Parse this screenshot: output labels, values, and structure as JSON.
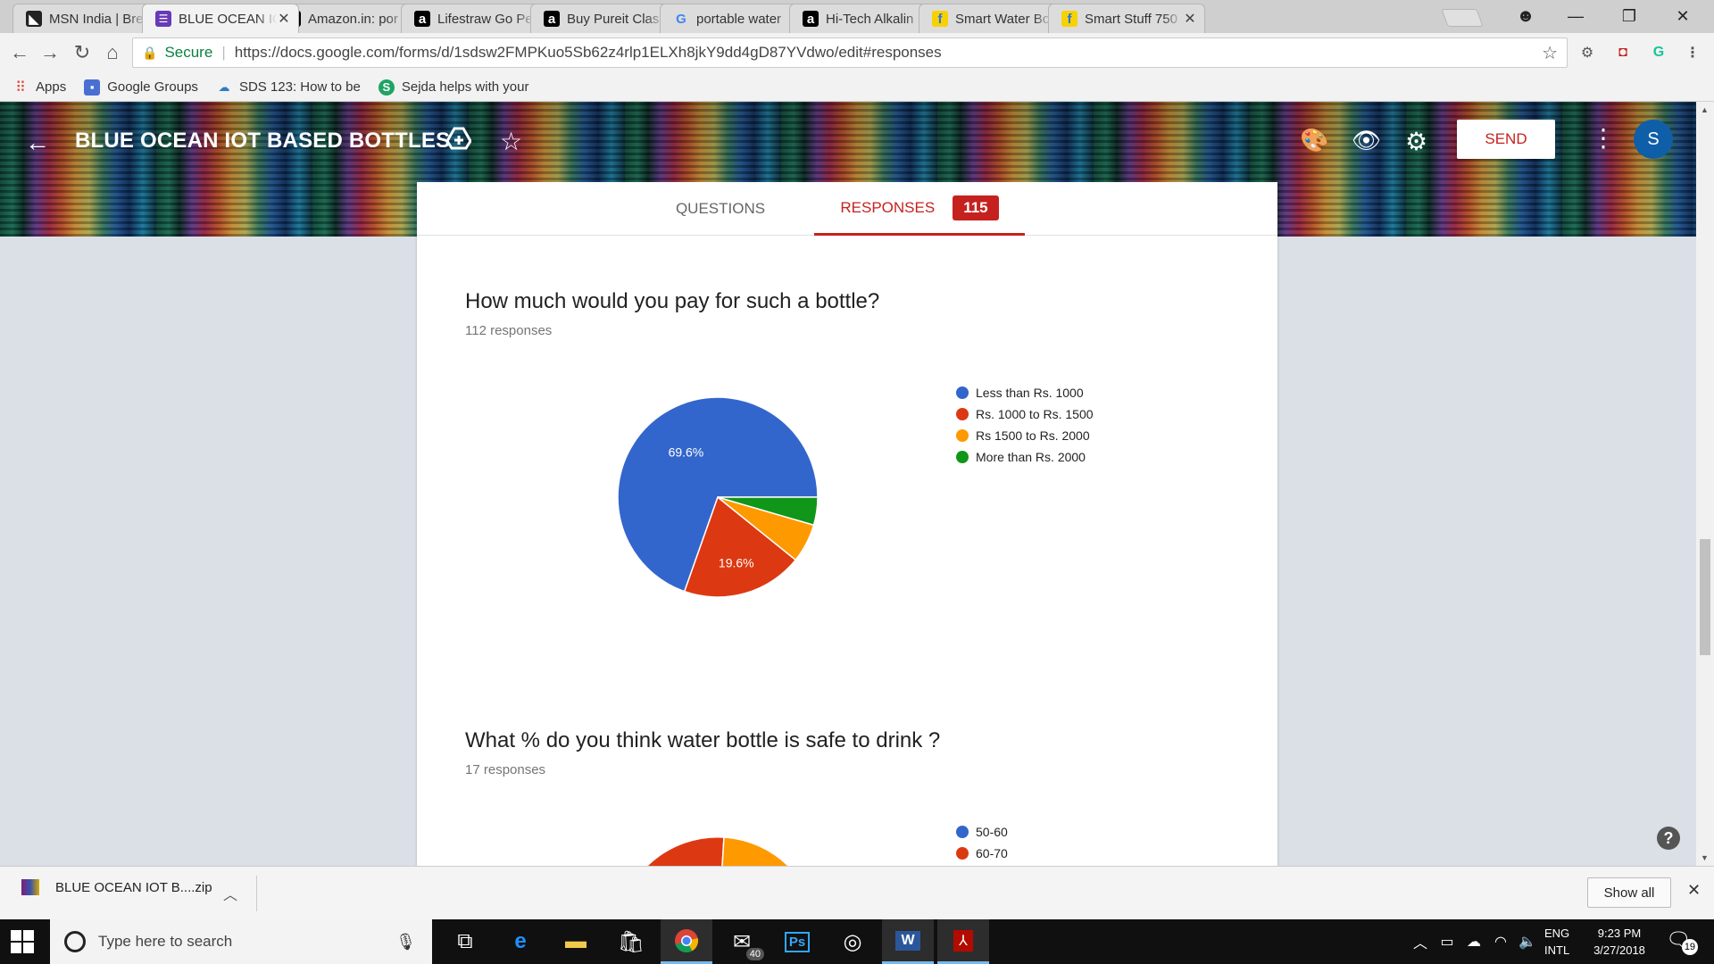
{
  "browser": {
    "tabs": [
      {
        "title": "MSN India | Bre",
        "icon": "msn-icon",
        "color": "#222222",
        "glyph": "◣",
        "active": false
      },
      {
        "title": "BLUE OCEAN IC",
        "icon": "google-forms-icon",
        "color": "#673ab7",
        "glyph": "☰",
        "active": true
      },
      {
        "title": "Amazon.in: por",
        "icon": "amazon-icon",
        "color": "#000000",
        "glyph": "a",
        "active": false
      },
      {
        "title": "Lifestraw Go Pe",
        "icon": "amazon-icon",
        "color": "#000000",
        "glyph": "a",
        "active": false
      },
      {
        "title": "Buy Pureit Clas",
        "icon": "amazon-icon",
        "color": "#000000",
        "glyph": "a",
        "active": false
      },
      {
        "title": "portable water",
        "icon": "google-icon",
        "color": "#4285f4",
        "glyph": "G",
        "active": false
      },
      {
        "title": "Hi-Tech Alkalin",
        "icon": "amazon-icon",
        "color": "#000000",
        "glyph": "a",
        "active": false
      },
      {
        "title": "Smart Water Bo",
        "icon": "flipkart-icon",
        "color": "#f7d200",
        "glyph": "f",
        "active": false
      },
      {
        "title": "Smart Stuff 750",
        "icon": "flipkart-icon",
        "color": "#f7d200",
        "glyph": "f",
        "active": false
      }
    ],
    "address": {
      "secure_label": "Secure",
      "url": "https://docs.google.com/forms/d/1sdsw2FMPKuo5Sb62z4rlp1ELXh8jkY9dd4gD87YVdwo/edit#responses"
    },
    "bookmarks": [
      {
        "label": "Apps",
        "icon": "apps-grid-icon"
      },
      {
        "label": "Google Groups",
        "icon": "google-groups-icon"
      },
      {
        "label": "SDS 123: How to be",
        "icon": "sds-icon"
      },
      {
        "label": "Sejda helps with your",
        "icon": "sejda-icon"
      }
    ]
  },
  "form": {
    "title": "BLUE OCEAN IOT BASED BOTTLES",
    "send_label": "SEND",
    "avatar_initial": "S",
    "tabs": {
      "questions": "QUESTIONS",
      "responses": "RESPONSES",
      "response_count": "115"
    },
    "questions": [
      {
        "title": "How much would you pay for such a bottle?",
        "responses": "112 responses"
      },
      {
        "title": "What % do you think water bottle is safe to drink ?",
        "responses": "17 responses"
      }
    ]
  },
  "chart_data": [
    {
      "type": "pie",
      "categories": [
        "Less than Rs. 1000",
        "Rs. 1000 to Rs. 1500",
        "Rs 1500 to Rs. 2000",
        "More than Rs. 2000"
      ],
      "values": [
        69.6,
        19.6,
        6.3,
        4.5
      ],
      "colors": [
        "#3366cc",
        "#dc3912",
        "#ff9900",
        "#109618"
      ],
      "data_labels": [
        "69.6%",
        "19.6%",
        "",
        ""
      ],
      "legend_position": "right"
    },
    {
      "type": "pie",
      "categories": [
        "50-60",
        "60-70"
      ],
      "colors": [
        "#3366cc",
        "#dc3912"
      ],
      "legend_position": "right"
    }
  ],
  "downloads": {
    "file": "BLUE OCEAN IOT B....zip",
    "show_all": "Show all"
  },
  "taskbar": {
    "search_placeholder": "Type here to search",
    "mail_badge": "40",
    "lang_1": "ENG",
    "lang_2": "INTL",
    "time": "9:23 PM",
    "date": "3/27/2018",
    "notif_count": "19"
  }
}
